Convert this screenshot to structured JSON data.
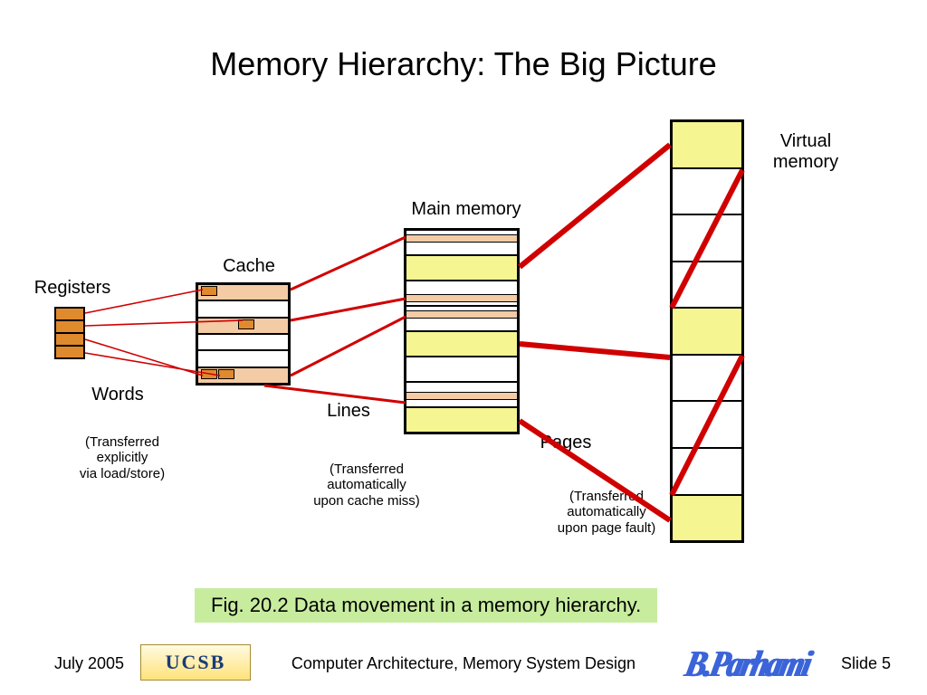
{
  "title": "Memory Hierarchy: The Big Picture",
  "levels": {
    "registers": {
      "label": "Registers",
      "transfer_unit": "Words",
      "transfer_note": "(Transferred\nexplicitly\nvia load/store)"
    },
    "cache": {
      "label": "Cache",
      "transfer_unit": "Lines",
      "transfer_note": "(Transferred\nautomatically\nupon cache miss)"
    },
    "main": {
      "label": "Main memory",
      "transfer_unit": "Pages",
      "transfer_note": "(Transferred\nautomatically\nupon page fault)"
    },
    "virtual": {
      "label": "Virtual\nmemory"
    }
  },
  "caption": "Fig. 20.2    Data movement in a memory hierarchy.",
  "footer": {
    "date": "July 2005",
    "course": "Computer Architecture, Memory System Design",
    "slide": "Slide 5",
    "org": "UCSB",
    "author": "B.Parhami"
  }
}
